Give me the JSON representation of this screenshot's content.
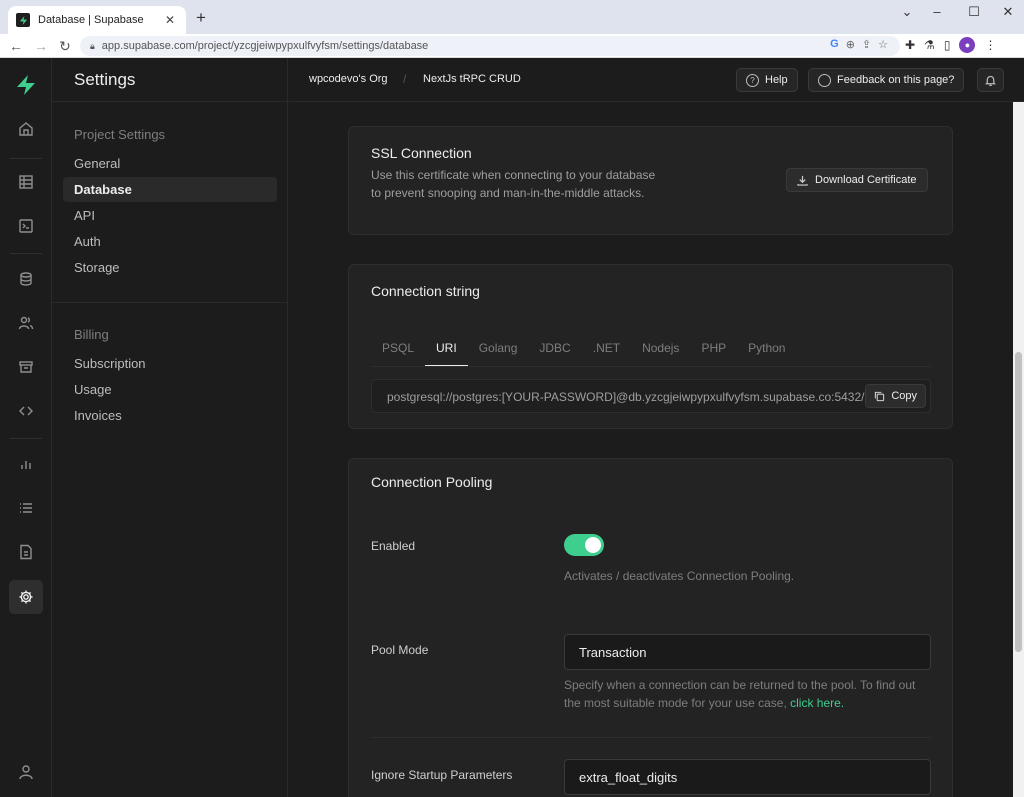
{
  "browser": {
    "tab_title": "Database | Supabase",
    "url": "app.supabase.com/project/yzcgjeiwpypxulfvyfsm/settings/database"
  },
  "sidebar": {
    "title": "Settings",
    "project_section": "Project Settings",
    "project_items": [
      {
        "label": "General"
      },
      {
        "label": "Database"
      },
      {
        "label": "API"
      },
      {
        "label": "Auth"
      },
      {
        "label": "Storage"
      }
    ],
    "billing_section": "Billing",
    "billing_items": [
      {
        "label": "Subscription"
      },
      {
        "label": "Usage"
      },
      {
        "label": "Invoices"
      }
    ],
    "active_item": "Database"
  },
  "header": {
    "org": "wpcodevo's Org",
    "project": "NextJs tRPC CRUD",
    "help_label": "Help",
    "feedback_label": "Feedback on this page?"
  },
  "ssl": {
    "title": "SSL Connection",
    "description": "Use this certificate when connecting to your database to prevent snooping and man-in-the-middle attacks.",
    "download_label": "Download Certificate"
  },
  "connection_string": {
    "title": "Connection string",
    "tabs": [
      {
        "label": "PSQL"
      },
      {
        "label": "URI"
      },
      {
        "label": "Golang"
      },
      {
        "label": "JDBC"
      },
      {
        "label": ".NET"
      },
      {
        "label": "Nodejs"
      },
      {
        "label": "PHP"
      },
      {
        "label": "Python"
      }
    ],
    "active_tab": "URI",
    "value": "postgresql://postgres:[YOUR-PASSWORD]@db.yzcgjeiwpypxulfvyfsm.supabase.co:5432/postgres",
    "copy_label": "Copy"
  },
  "pooling": {
    "title": "Connection Pooling",
    "enabled_label": "Enabled",
    "enabled_help": "Activates / deactivates Connection Pooling.",
    "pool_mode_label": "Pool Mode",
    "pool_mode_value": "Transaction",
    "pool_mode_help": "Specify when a connection can be returned to the pool. To find out the most suitable mode for your use case,",
    "pool_mode_link": "click here.",
    "ignore_label": "Ignore Startup Parameters",
    "ignore_value": "extra_float_digits"
  },
  "colors": {
    "accent": "#3ecf8e",
    "background": "#1c1c1c",
    "card": "#232323"
  }
}
